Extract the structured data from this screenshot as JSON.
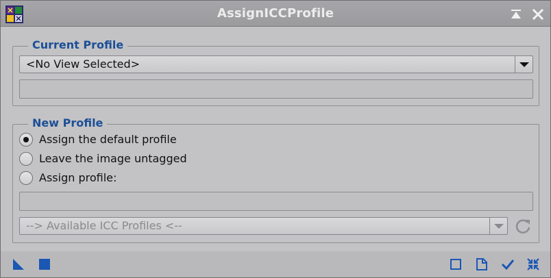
{
  "window": {
    "title": "AssignICCProfile",
    "title_color": "#ececec",
    "accent_color": "#1c4f97"
  },
  "titlebar_buttons": [
    {
      "icon": "shade-up-icon"
    },
    {
      "icon": "close-icon"
    }
  ],
  "current_profile": {
    "title": "Current Profile",
    "view_selector": {
      "selected": "<No View Selected>"
    },
    "profile_field": {
      "value": ""
    }
  },
  "new_profile": {
    "title": "New Profile",
    "options": [
      {
        "label": "Assign the default profile",
        "selected": true
      },
      {
        "label": "Leave the image untagged",
        "selected": false
      },
      {
        "label": "Assign profile:",
        "selected": false
      }
    ],
    "profile_path_field": {
      "value": ""
    },
    "available_profiles": {
      "selected": "--> Available ICC Profiles <--",
      "disabled": true
    },
    "refresh_icon": "refresh-icon"
  },
  "bottombar": {
    "left_icons": [
      "new-instance-icon",
      "browse-documentation-icon"
    ],
    "right_icons": [
      "reset-icon",
      "view-source-icon",
      "apply-icon",
      "collapse-icon"
    ]
  }
}
